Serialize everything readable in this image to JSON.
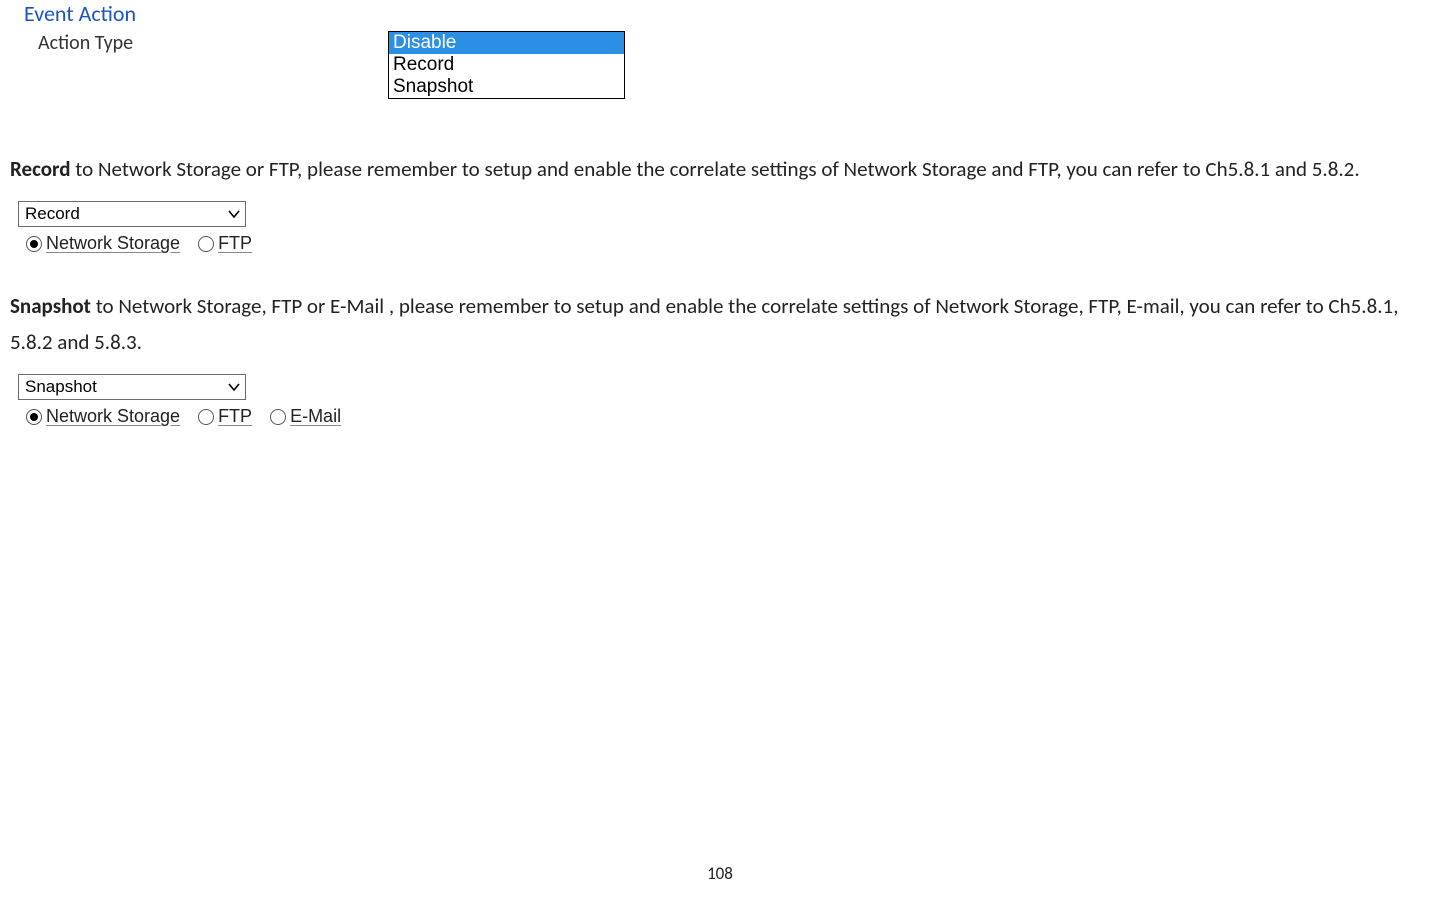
{
  "header": {
    "title": "Event Action",
    "label": "Action Type"
  },
  "action_type_listbox": {
    "options": [
      "Disable",
      "Record",
      "Snapshot"
    ],
    "selected": "Disable"
  },
  "record_section": {
    "bold": "Record",
    "text": " to Network Storage or FTP, please remember to setup and enable the correlate settings of Network Storage and FTP, you can refer to Ch5.8.1 and 5.8.2.",
    "select_value": "Record",
    "radios": [
      {
        "label": "Network Storage",
        "checked": true
      },
      {
        "label": "FTP",
        "checked": false
      }
    ]
  },
  "snapshot_section": {
    "bold": "Snapshot",
    "text": " to Network Storage, FTP or E-Mail , please remember to setup and enable the correlate settings of Network Storage, FTP, E-mail, you can refer to Ch5.8.1, 5.8.2 and 5.8.3.",
    "select_value": "Snapshot",
    "radios": [
      {
        "label": "Network Storage",
        "checked": true
      },
      {
        "label": "FTP",
        "checked": false
      },
      {
        "label": "E-Mail",
        "checked": false
      }
    ]
  },
  "page_number": "108"
}
